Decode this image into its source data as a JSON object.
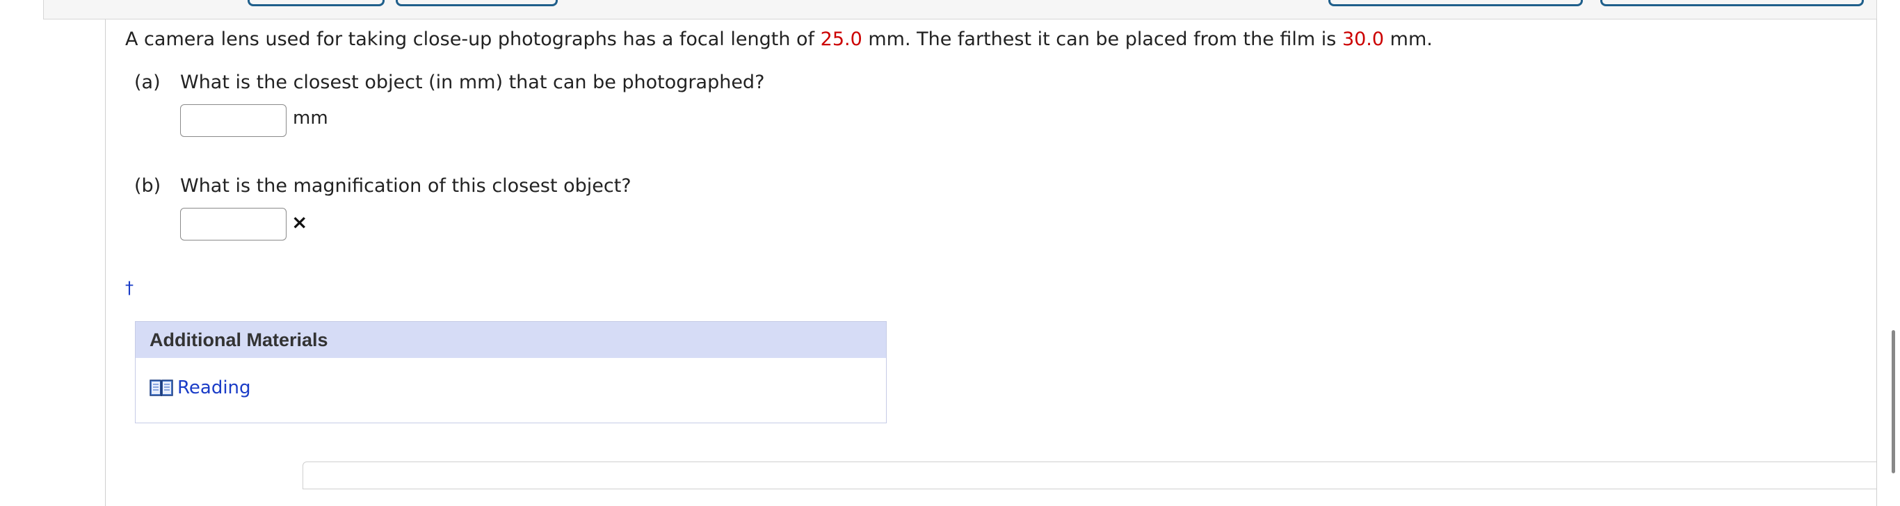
{
  "question": {
    "intro": "A camera lens used for taking close-up photographs has a focal length of ",
    "focal_length": "25.0",
    "mid": " mm. The farthest it can be placed from the film is ",
    "max_distance": "30.0",
    "end": " mm."
  },
  "parts": [
    {
      "letter": "(a)",
      "text": "What is the closest object (in mm) that can be photographed?",
      "unit": "mm",
      "value": ""
    },
    {
      "letter": "(b)",
      "text": "What is the magnification of this closest object?",
      "unit": "×",
      "value": ""
    }
  ],
  "footnote": "†",
  "materials": {
    "title": "Additional Materials",
    "link_label": "Reading",
    "link_icon": "book-icon"
  },
  "colors": {
    "given_value": "#cc0000",
    "link": "#1a3cc7",
    "materials_header": "#d6dcf6"
  }
}
